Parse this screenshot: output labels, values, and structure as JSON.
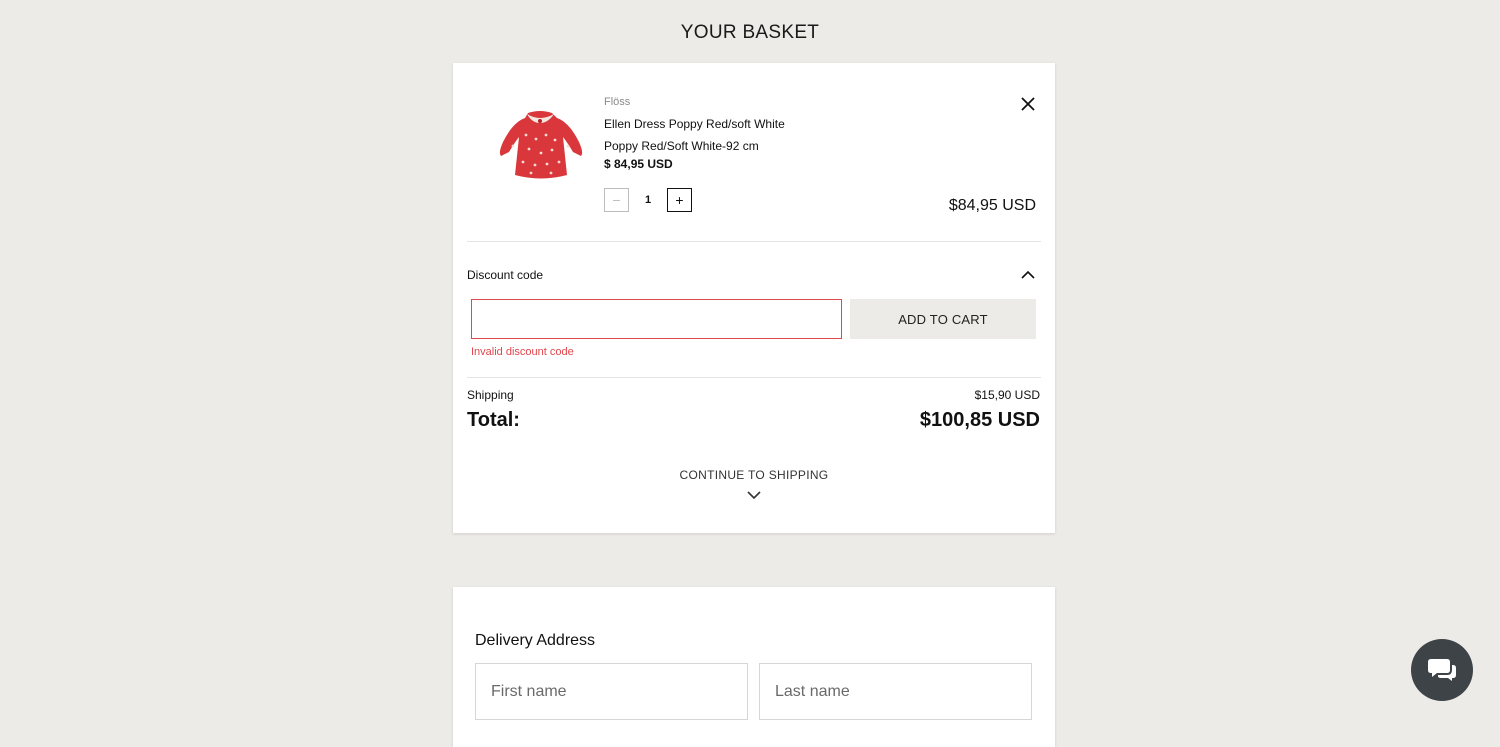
{
  "page": {
    "title": "YOUR BASKET"
  },
  "item": {
    "brand": "Flöss",
    "name": "Ellen Dress Poppy Red/soft White",
    "variant": "Poppy Red/Soft White-92 cm",
    "unit_price": "$ 84,95 USD",
    "quantity": "1",
    "line_total": "$84,95 USD",
    "image_icon": "red-dress-product-image"
  },
  "discount": {
    "label": "Discount code",
    "value": "",
    "button_label": "ADD TO CART",
    "error": "Invalid discount code"
  },
  "summary": {
    "shipping_label": "Shipping",
    "shipping_value": "$15,90 USD",
    "total_label": "Total:",
    "total_value": "$100,85 USD",
    "continue_label": "CONTINUE TO SHIPPING"
  },
  "address": {
    "title": "Delivery Address",
    "first_name_placeholder": "First name",
    "last_name_placeholder": "Last name"
  },
  "colors": {
    "background": "#ecebe7",
    "error": "#e0474c",
    "chat_button": "#3d4347"
  }
}
